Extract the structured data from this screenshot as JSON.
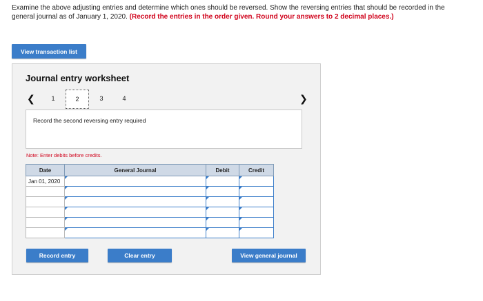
{
  "instructions": {
    "text": "Examine the above adjusting entries and determine which ones should be reversed. Show the reversing entries that should be recorded in the general journal as of January 1, 2020.",
    "emphasis": "(Record the entries in the order given. Round your answers to 2 decimal places.)"
  },
  "buttons": {
    "view_transaction_list": "View transaction list",
    "record_entry": "Record entry",
    "clear_entry": "Clear entry",
    "view_general_journal": "View general journal"
  },
  "worksheet": {
    "title": "Journal entry worksheet",
    "pages": [
      "1",
      "2",
      "3",
      "4"
    ],
    "current_page": "2",
    "prev_icon": "chevron-left-icon",
    "next_icon": "chevron-right-icon",
    "prompt": "Record the second reversing entry required",
    "note": "Note: Enter debits before credits."
  },
  "journal": {
    "headers": {
      "date": "Date",
      "general_journal": "General Journal",
      "debit": "Debit",
      "credit": "Credit"
    },
    "rows": [
      {
        "date": "Jan 01, 2020",
        "account": "",
        "debit": "",
        "credit": ""
      },
      {
        "date": "",
        "account": "",
        "debit": "",
        "credit": ""
      },
      {
        "date": "",
        "account": "",
        "debit": "",
        "credit": ""
      },
      {
        "date": "",
        "account": "",
        "debit": "",
        "credit": ""
      },
      {
        "date": "",
        "account": "",
        "debit": "",
        "credit": ""
      },
      {
        "date": "",
        "account": "",
        "debit": "",
        "credit": ""
      }
    ]
  },
  "colors": {
    "accent": "#3b7dc9",
    "emphasis": "#d0021b",
    "header_bg": "#cfd9e6"
  }
}
